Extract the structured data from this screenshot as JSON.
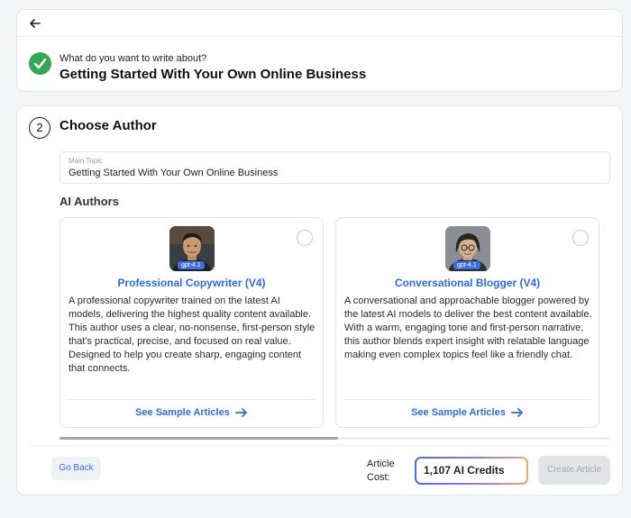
{
  "prompt_card": {
    "question": "What do you want to write about?",
    "answer": "Getting Started With Your Own Online Business"
  },
  "step": {
    "number": "2",
    "title": "Choose Author",
    "topic_label": "Main Topic",
    "topic_value": "Getting Started With Your Own Online Business",
    "section_title": "AI Authors"
  },
  "authors": [
    {
      "model": "gpt-4.1",
      "name": "Professional Copywriter (V4)",
      "description": "A professional copywriter trained on the latest AI models, delivering the highest quality content available. This author uses a clear, no-nonsense, first-person style that's practical, precise, and focused on real value. Designed to help you create sharp, engaging content that connects.",
      "sample_link": "See Sample Articles"
    },
    {
      "model": "gpt-4.1",
      "name": "Conversational Blogger (V4)",
      "description": "A conversational and approachable blogger powered by the latest AI models to deliver the best content available. With a warm, engaging tone and first-person narrative, this author blends expert insight with relatable language making even complex topics feel like a friendly chat.",
      "sample_link": "See Sample Articles"
    }
  ],
  "footer": {
    "go_back": "Go Back",
    "cost_label": "Article Cost:",
    "credits": "1,107 AI Credits",
    "create": "Create Article"
  },
  "colors": {
    "accent": "#2f6bd9",
    "success": "#36a853"
  }
}
